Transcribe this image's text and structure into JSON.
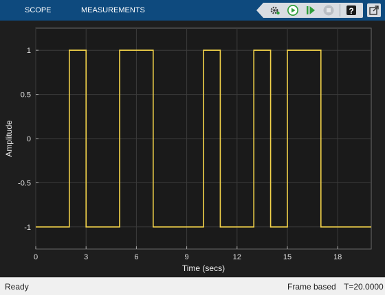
{
  "toolbar": {
    "tabs": [
      "SCOPE",
      "MEASUREMENTS"
    ],
    "icons": [
      "back-arrow-icon",
      "settings-gear-icon",
      "run-icon",
      "step-forward-icon",
      "stop-icon",
      "help-icon",
      "undock-icon"
    ],
    "colors": {
      "bar": "#0e4a7e",
      "tab_text": "#ffffff",
      "run_green": "#2e9e3a"
    }
  },
  "plot": {
    "background": "#1a1a1a",
    "grid_color": "#3c3c3c",
    "line_color": "#f3d34a",
    "xlabel": "Time (secs)",
    "ylabel": "Amplitude"
  },
  "chart_data": {
    "type": "line",
    "xlabel": "Time (secs)",
    "ylabel": "Amplitude",
    "xlim": [
      0,
      20
    ],
    "ylim": [
      -1.25,
      1.25
    ],
    "xticks": [
      0,
      3,
      6,
      9,
      12,
      15,
      18
    ],
    "yticks": [
      -1,
      -0.5,
      0,
      0.5,
      1
    ],
    "xtick_labels": [
      "0",
      "3",
      "6",
      "9",
      "12",
      "15",
      "18"
    ],
    "ytick_labels": [
      "-1",
      "-0.5",
      "0",
      "0.5",
      "1"
    ],
    "grid": true,
    "series": [
      {
        "x": [
          0,
          2,
          2,
          3,
          3,
          5,
          5,
          7,
          7,
          10,
          10,
          11,
          11,
          13,
          13,
          14,
          14,
          15,
          15,
          17,
          17,
          20
        ],
        "y": [
          -1,
          -1,
          1,
          1,
          -1,
          -1,
          1,
          1,
          -1,
          -1,
          1,
          1,
          -1,
          -1,
          1,
          1,
          -1,
          -1,
          1,
          1,
          -1,
          -1
        ]
      }
    ]
  },
  "status": {
    "left": "Ready",
    "mode": "Frame based",
    "time": "T=20.0000"
  }
}
